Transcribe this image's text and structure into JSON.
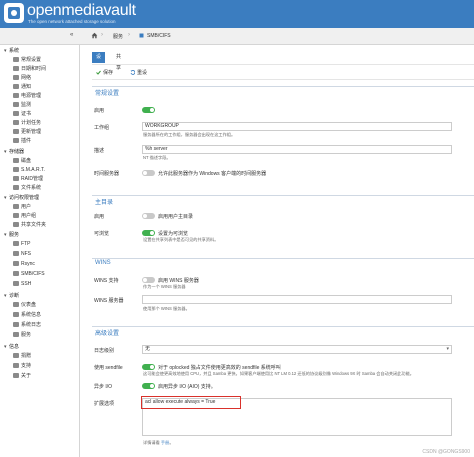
{
  "header": {
    "brand": "openmediavault",
    "tagline": "The open network attached storage solution"
  },
  "breadcrumb": {
    "collapse_icon": "«",
    "home_icon": "home-icon",
    "service": "服务",
    "current": "SMB/CIFS"
  },
  "sidebar": {
    "groups": [
      {
        "label": "系统",
        "items": [
          "常规设置",
          "日期和时间",
          "网络",
          "通知",
          "电源管理",
          "监测",
          "证书",
          "计划任务",
          "更新管理",
          "插件"
        ]
      },
      {
        "label": "存储器",
        "items": [
          "磁盘",
          "S.M.A.R.T.",
          "RAID管理",
          "文件系统"
        ]
      },
      {
        "label": "访问权限管理",
        "items": [
          "用户",
          "用户组",
          "共享文件夹"
        ]
      },
      {
        "label": "服务",
        "items": [
          "FTP",
          "NFS",
          "Rsync",
          "SMB/CIFS",
          "SSH"
        ]
      },
      {
        "label": "诊断",
        "items": [
          "仪表盘",
          "系统信息",
          "系统日志",
          "服务"
        ]
      },
      {
        "label": "信息",
        "items": [
          "捐赠",
          "支持",
          "关于"
        ]
      }
    ]
  },
  "tabs": [
    "设置",
    "共享"
  ],
  "toolbar": {
    "save": "保存",
    "reset": "重设"
  },
  "general": {
    "title": "常规设置",
    "enable_label": "启用",
    "enable_on": true,
    "workgroup_label": "工作组",
    "workgroup_value": "WORKGROUP",
    "workgroup_help": "服务器所在的工作组，服务器会出现在这工作组。",
    "desc_label": "描述",
    "desc_value": "%h server",
    "desc_help": "NT 描述字段。",
    "timeserver_label": "时间服务器",
    "timeserver_on": false,
    "timeserver_text": "允许此服务器作为 Windows 客户端的时间服务器"
  },
  "home": {
    "title": "主目录",
    "enable_label": "启用",
    "enable_on": false,
    "enable_text": "启用用户主目录",
    "browse_label": "可浏览",
    "browse_on": true,
    "browse_text": "设置为可浏览",
    "browse_help": "设置在共享列表中是否可见的共享资料。"
  },
  "wins": {
    "title": "WINS",
    "support_label": "WINS 支持",
    "support_on": false,
    "support_text": "启用 WINS 服务器",
    "support_help": "作为一个 WINS 服务器",
    "server_label": "WINS 服务器",
    "server_help": "使用那个 WINS 服务器。"
  },
  "advanced": {
    "title": "高级设置",
    "log_label": "日志级别",
    "log_value": "无",
    "sendfile_label": "使用 sendfile",
    "sendfile_on": true,
    "sendfile_text": "对于 oplocked 独占文件使用更高效的 sendfile 系统呼叫",
    "sendfile_help": "这可能会使更高效地使用 CPU，并且 Samba 更快。如果客户端使用比 NT LM 0.12 还低的协议级别像 Windows 9X 时 Samba 会自动关闭此功能。",
    "asyncio_label": "异步 I/O",
    "asyncio_on": true,
    "asyncio_text": "启用异步 I/O (AIO) 支持。",
    "extra_label": "扩展选项",
    "extra_value": "acl allow execute always = True",
    "extra_help_prefix": "详情请看 ",
    "extra_help_link": "手册",
    "extra_help_suffix": "。"
  },
  "watermark": "CSDN @GONGS900",
  "colors": {
    "accent": "#3b7dc0",
    "toggle_on": "#40b04f",
    "highlight": "#d9312b"
  }
}
